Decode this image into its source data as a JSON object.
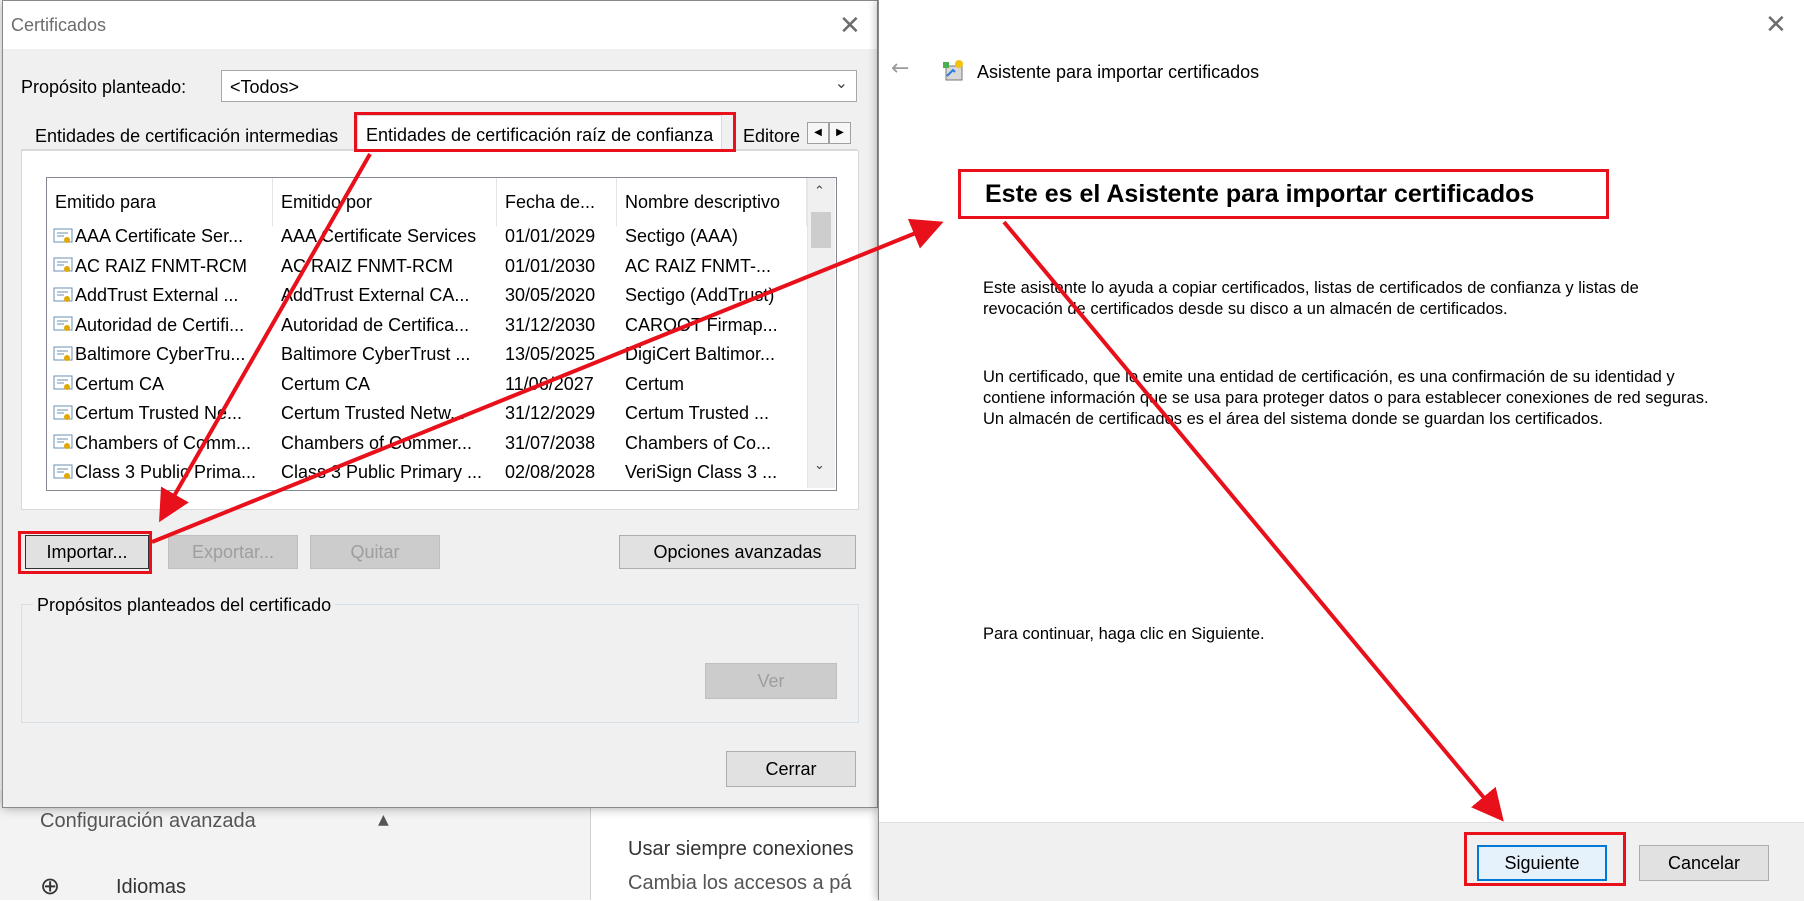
{
  "background": {
    "settings_section": "Configuración avanzada",
    "languages_item": "Idiomas",
    "right_text_1": "Usar siempre conexiones",
    "right_text_2": "Cambia los accesos a pá"
  },
  "certificates_dialog": {
    "title": "Certificados",
    "purpose_label": "Propósito planteado:",
    "purpose_value": "<Todos>",
    "tabs": [
      "Entidades de certificación intermedias",
      "Entidades de certificación raíz de confianza",
      "Editore"
    ],
    "columns": [
      "Emitido para",
      "Emitido por",
      "Fecha de...",
      "Nombre descriptivo"
    ],
    "rows": [
      {
        "issued_to": "AAA Certificate Ser...",
        "issued_by": "AAA Certificate Services",
        "date": "01/01/2029",
        "name": "Sectigo (AAA)"
      },
      {
        "issued_to": "AC RAIZ FNMT-RCM",
        "issued_by": "AC RAIZ FNMT-RCM",
        "date": "01/01/2030",
        "name": "AC RAIZ FNMT-..."
      },
      {
        "issued_to": "AddTrust External ...",
        "issued_by": "AddTrust External CA...",
        "date": "30/05/2020",
        "name": "Sectigo (AddTrust)"
      },
      {
        "issued_to": "Autoridad de Certifi...",
        "issued_by": "Autoridad de Certifica...",
        "date": "31/12/2030",
        "name": "CAROOT Firmap..."
      },
      {
        "issued_to": "Baltimore CyberTru...",
        "issued_by": "Baltimore CyberTrust ...",
        "date": "13/05/2025",
        "name": "DigiCert Baltimor..."
      },
      {
        "issued_to": "Certum CA",
        "issued_by": "Certum CA",
        "date": "11/06/2027",
        "name": "Certum"
      },
      {
        "issued_to": "Certum Trusted Ne...",
        "issued_by": "Certum Trusted Netw...",
        "date": "31/12/2029",
        "name": "Certum Trusted ..."
      },
      {
        "issued_to": "Chambers of Comm...",
        "issued_by": "Chambers of Commer...",
        "date": "31/07/2038",
        "name": "Chambers of Co..."
      },
      {
        "issued_to": "Class 3 Public Prima...",
        "issued_by": "Class 3 Public Primary ...",
        "date": "02/08/2028",
        "name": "VeriSign Class 3 ..."
      }
    ],
    "import_button": "Importar...",
    "export_button": "Exportar...",
    "remove_button": "Quitar",
    "advanced_button": "Opciones avanzadas",
    "purposes_group": "Propósitos planteados del certificado",
    "view_button": "Ver",
    "close_button": "Cerrar"
  },
  "wizard": {
    "title": "Asistente para importar certificados",
    "heading": "Este es el Asistente para importar certificados",
    "paragraph1": "Este asistente lo ayuda a copiar certificados, listas de certificados de confianza y listas de revocación de certificados desde su disco a un almacén de certificados.",
    "paragraph2": "Un certificado, que lo emite una entidad de certificación, es una confirmación de su identidad y contiene información que se usa para proteger datos o para establecer conexiones de red seguras. Un almacén de certificados es el área del sistema donde se guardan los certificados.",
    "paragraph3": "Para continuar, haga clic en Siguiente.",
    "next_button": "Siguiente",
    "cancel_button": "Cancelar"
  },
  "colors": {
    "annotation_red": "#e8101a",
    "dialog_bg": "#f0f0f0",
    "accent_blue": "#0078d7"
  },
  "icons": [
    "close-icon",
    "chevron-down-icon",
    "certificate-icon",
    "back-arrow-icon",
    "wizard-icon",
    "globe-icon",
    "chevron-up-icon"
  ]
}
